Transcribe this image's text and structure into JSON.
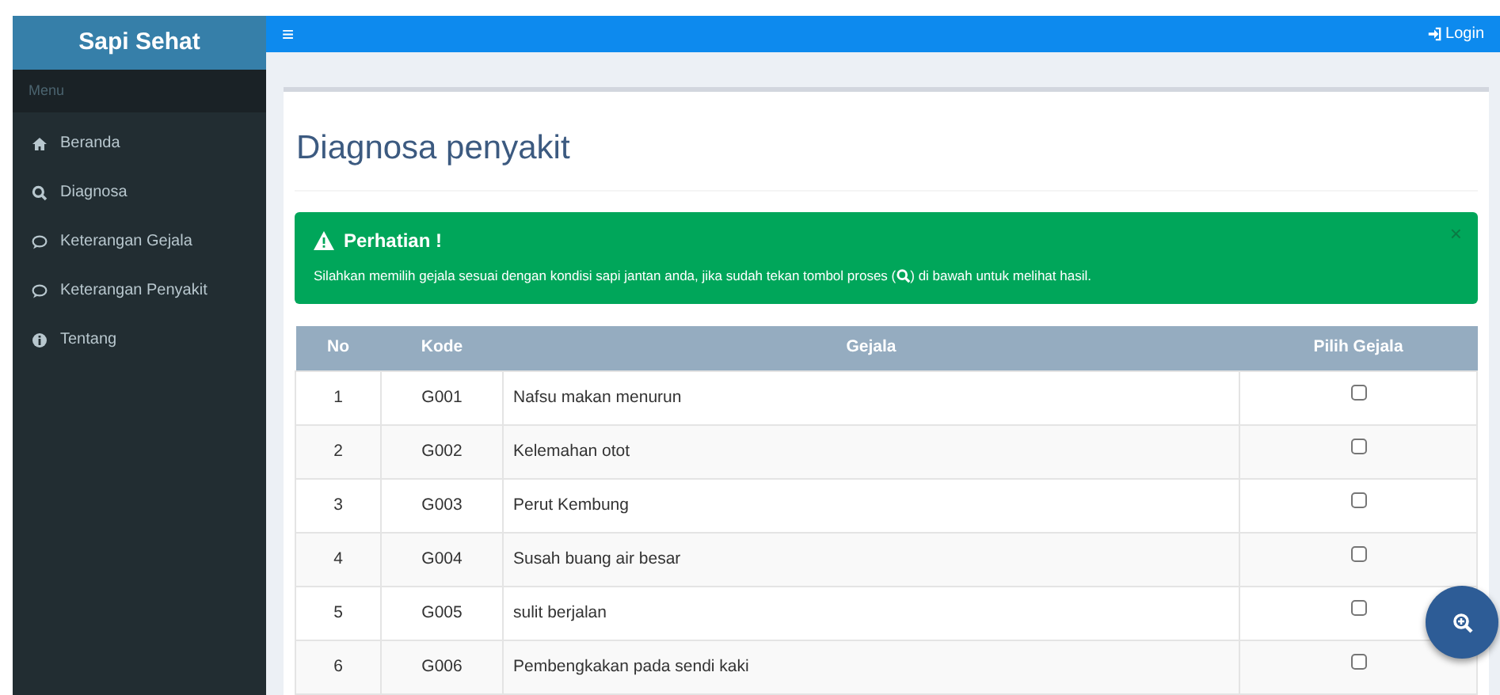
{
  "brand": "Sapi Sehat",
  "topbar": {
    "menu_icon": "≡",
    "login": "Login"
  },
  "sidebar": {
    "header": "Menu",
    "items": [
      {
        "label": "Beranda",
        "selected": false
      },
      {
        "label": "Diagnosa",
        "selected": false
      },
      {
        "label": "Keterangan Gejala",
        "selected": false
      },
      {
        "label": "Keterangan Penyakit",
        "selected": false
      },
      {
        "label": "Tentang",
        "selected": false
      }
    ]
  },
  "page_title": "Diagnosa penyakit",
  "alert": {
    "title": "Perhatian !",
    "message_before": "Silahkan memilih gejala sesuai dengan kondisi sapi jantan anda, jika sudah tekan tombol proses (",
    "message_after": ") di bawah untuk melihat hasil.",
    "close": "×"
  },
  "table": {
    "columns": [
      "No",
      "Kode",
      "Gejala",
      "Pilih Gejala"
    ],
    "rows": [
      {
        "no": "1",
        "kode": "G001",
        "gejala": "Nafsu makan menurun",
        "checked": false
      },
      {
        "no": "2",
        "kode": "G002",
        "gejala": "Kelemahan otot",
        "checked": false
      },
      {
        "no": "3",
        "kode": "G003",
        "gejala": "Perut Kembung",
        "checked": false
      },
      {
        "no": "4",
        "kode": "G004",
        "gejala": "Susah buang air besar",
        "checked": false
      },
      {
        "no": "5",
        "kode": "G005",
        "gejala": "sulit berjalan",
        "checked": false
      },
      {
        "no": "6",
        "kode": "G006",
        "gejala": "Pembengkakan pada sendi kaki",
        "checked": false
      }
    ]
  }
}
